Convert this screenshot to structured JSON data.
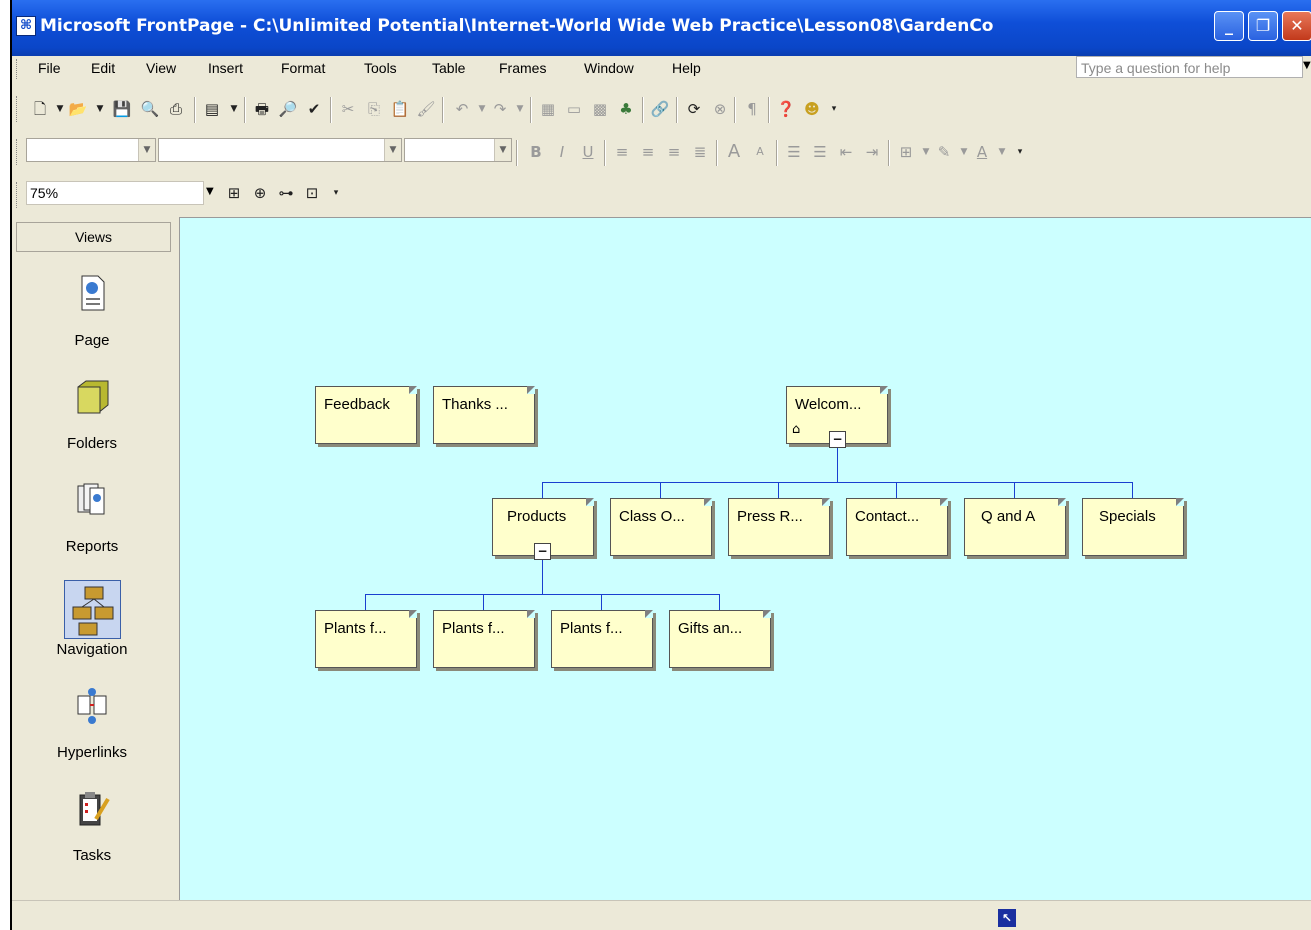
{
  "window": {
    "title": "Microsoft FrontPage - C:\\Unlimited Potential\\Internet-World Wide Web Practice\\Lesson08\\GardenCo",
    "app_icon": "frontpage-icon",
    "controls": [
      "minimize",
      "restore",
      "close"
    ]
  },
  "menubar": {
    "items": [
      "File",
      "Edit",
      "View",
      "Insert",
      "Format",
      "Tools",
      "Table",
      "Frames",
      "Window",
      "Help"
    ],
    "help_placeholder": "Type a question for help"
  },
  "navigation_toolbar": {
    "zoom_value": "75%"
  },
  "views_pane": {
    "header": "Views",
    "items": [
      {
        "label": "Page",
        "icon": "page-view-icon",
        "selected": false
      },
      {
        "label": "Folders",
        "icon": "folders-view-icon",
        "selected": false
      },
      {
        "label": "Reports",
        "icon": "reports-view-icon",
        "selected": false
      },
      {
        "label": "Navigation",
        "icon": "navigation-view-icon",
        "selected": true
      },
      {
        "label": "Hyperlinks",
        "icon": "hyperlinks-view-icon",
        "selected": false
      },
      {
        "label": "Tasks",
        "icon": "tasks-view-icon",
        "selected": false
      }
    ]
  },
  "navigation_map": {
    "top_level": [
      {
        "label": "Feedback"
      },
      {
        "label": "Thanks ..."
      }
    ],
    "home": {
      "label": "Welcom...",
      "home_icon": "home-icon"
    },
    "children": [
      {
        "label": "Products"
      },
      {
        "label": "Class O..."
      },
      {
        "label": "Press R..."
      },
      {
        "label": "Contact..."
      },
      {
        "label": "Q and A"
      },
      {
        "label": "Specials"
      }
    ],
    "products_children": [
      {
        "label": "Plants f..."
      },
      {
        "label": "Plants f..."
      },
      {
        "label": "Plants f..."
      },
      {
        "label": "Gifts an..."
      }
    ]
  },
  "colors": {
    "title_bar": "#0A46C8",
    "canvas_background": "#CCFFFF",
    "node_fill": "#FFFFCC",
    "connector": "#1A3FD0",
    "chrome": "#ECE9D8"
  }
}
